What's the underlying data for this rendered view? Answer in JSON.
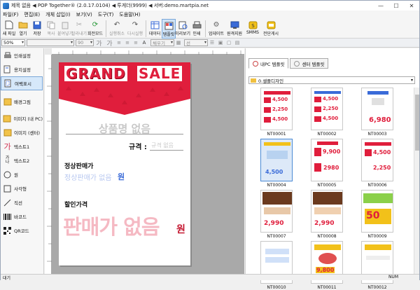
{
  "window": {
    "title": "제목 없음 ◀ POP Together® (2.0.17.0104) ◀ 투게더(9999) ◀ 서버:demo.martpia.net"
  },
  "menu": [
    "파일(F)",
    "편집(E)",
    "개체 삽입(I)",
    "보기(V)",
    "도구(T)",
    "도움말(H)"
  ],
  "toolbar": [
    {
      "name": "new-file-button",
      "icon": "new-file-icon",
      "label": "새 파일",
      "enabled": true
    },
    {
      "name": "open-button",
      "icon": "folder-icon",
      "label": "열기",
      "enabled": true
    },
    {
      "name": "save-button",
      "icon": "save-icon",
      "label": "저장",
      "enabled": true
    },
    {
      "name": "copy-button",
      "icon": "copy-icon",
      "label": "복사",
      "enabled": false
    },
    {
      "name": "paste-button",
      "icon": "paste-icon",
      "label": "붙여넣기",
      "enabled": false
    },
    {
      "name": "cut-button",
      "icon": "cut-icon",
      "label": "잘라내기",
      "enabled": false
    },
    {
      "name": "rotate-mode-button",
      "icon": "rotate-icon",
      "label": "회전모드",
      "enabled": true
    },
    {
      "name": "undo-button",
      "icon": "undo-icon",
      "label": "실행취소",
      "enabled": false
    },
    {
      "name": "redo-button",
      "icon": "redo-icon",
      "label": "다시실행",
      "enabled": false
    },
    {
      "name": "data-button",
      "icon": "data-icon",
      "label": "데이터",
      "enabled": true
    },
    {
      "name": "template-button",
      "icon": "template-icon",
      "label": "템플릿",
      "enabled": true,
      "active": true
    },
    {
      "name": "preview-button",
      "icon": "preview-icon",
      "label": "미리보기",
      "enabled": true
    },
    {
      "name": "print-button",
      "icon": "print-icon",
      "label": "인쇄",
      "enabled": true
    },
    {
      "name": "update-button",
      "icon": "gear-icon",
      "label": "업데이트",
      "enabled": true
    },
    {
      "name": "remote-support-button",
      "icon": "remote-icon",
      "label": "원격지원",
      "enabled": true
    },
    {
      "name": "smms-button",
      "icon": "smms-icon",
      "label": "SMMS",
      "enabled": true
    },
    {
      "name": "board-button",
      "icon": "board-icon",
      "label": "전단게시",
      "enabled": true
    }
  ],
  "format_bar": {
    "zoom": "50%",
    "font_size": "90",
    "font_style_a": "가",
    "font_style_b": "가",
    "color_label": "채우기",
    "line_label": "선"
  },
  "left_panel": [
    {
      "name": "print-settings",
      "icon": "printer-icon",
      "label": "인쇄설정"
    },
    {
      "name": "paper-settings",
      "icon": "paper-icon",
      "label": "용지설정"
    },
    {
      "name": "margin-display",
      "icon": "margin-icon",
      "label": "여백표시",
      "active": true
    },
    {
      "name": "background-image",
      "icon": "image-icon",
      "label": "배경그림"
    },
    {
      "name": "image-my-pc",
      "icon": "image-icon",
      "label": "이미지 (내 PC)"
    },
    {
      "name": "image-center",
      "icon": "image-icon",
      "label": "이미지 (센터)"
    },
    {
      "name": "text1",
      "icon": "text-icon",
      "label": "텍스트1"
    },
    {
      "name": "text2",
      "icon": "vertical-text-icon",
      "label": "텍스트2"
    },
    {
      "name": "circle",
      "icon": "circle-icon",
      "label": "원"
    },
    {
      "name": "rectangle",
      "icon": "rectangle-icon",
      "label": "사각형"
    },
    {
      "name": "line",
      "icon": "line-icon",
      "label": "직선"
    },
    {
      "name": "barcode",
      "icon": "barcode-icon",
      "label": "바코드"
    },
    {
      "name": "qrcode",
      "icon": "qrcode-icon",
      "label": "QR코드"
    }
  ],
  "pop": {
    "banner_word1": "GRAND",
    "banner_word2": "SALE",
    "product_name": "상품명 없음",
    "spec_label": "규격 :",
    "spec_value": "규격 없음",
    "regular_price_label": "정상판매가",
    "regular_price_value": "정상판매가 없음",
    "won": "원",
    "discount_label": "할인가격",
    "sale_price_value": "판매가 없음",
    "colors": {
      "red": "#e01e3c",
      "pink": "#f5b9c3",
      "blue": "#3a6bd8"
    }
  },
  "right_panel": {
    "tab_my": "내PC 템플릿",
    "tab_center": "센터 템플릿",
    "folder": "0.셀플디자인",
    "templates": [
      {
        "id": "NT00001"
      },
      {
        "id": "NT00002"
      },
      {
        "id": "NT00003"
      },
      {
        "id": "NT00004",
        "selected": true
      },
      {
        "id": "NT00005"
      },
      {
        "id": "NT00006"
      },
      {
        "id": "NT00007"
      },
      {
        "id": "NT00008"
      },
      {
        "id": "NT00009"
      },
      {
        "id": "NT00010"
      },
      {
        "id": "NT00011"
      },
      {
        "id": "NT00012"
      }
    ],
    "thumb_prices": {
      "p4500": "4,500",
      "p2250": "2,250",
      "p6980": "6,980",
      "p9900": "9,900",
      "p2980": "2980",
      "p2990": "2,990",
      "p50": "50",
      "p9800": "9,800"
    }
  },
  "status": {
    "left": "대기",
    "right": "NUM"
  }
}
